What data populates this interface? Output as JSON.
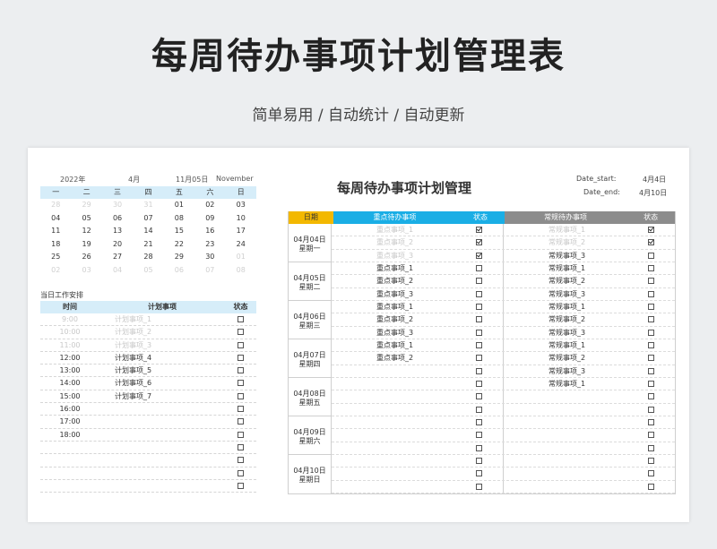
{
  "title": "每周待办事项计划管理表",
  "subtitle": "简单易用  /  自动统计  /  自动更新",
  "calendar": {
    "year": "2022年",
    "month": "4月",
    "date": "11月05日",
    "month_en": "November",
    "weekdays": [
      "一",
      "二",
      "三",
      "四",
      "五",
      "六",
      "日"
    ],
    "weeks": [
      [
        {
          "d": "28",
          "dim": true
        },
        {
          "d": "29",
          "dim": true
        },
        {
          "d": "30",
          "dim": true
        },
        {
          "d": "31",
          "dim": true
        },
        {
          "d": "01"
        },
        {
          "d": "02"
        },
        {
          "d": "03"
        }
      ],
      [
        {
          "d": "04"
        },
        {
          "d": "05"
        },
        {
          "d": "06"
        },
        {
          "d": "07"
        },
        {
          "d": "08"
        },
        {
          "d": "09"
        },
        {
          "d": "10"
        }
      ],
      [
        {
          "d": "11"
        },
        {
          "d": "12"
        },
        {
          "d": "13"
        },
        {
          "d": "14"
        },
        {
          "d": "15"
        },
        {
          "d": "16"
        },
        {
          "d": "17"
        }
      ],
      [
        {
          "d": "18"
        },
        {
          "d": "19"
        },
        {
          "d": "20"
        },
        {
          "d": "21"
        },
        {
          "d": "22"
        },
        {
          "d": "23"
        },
        {
          "d": "24"
        }
      ],
      [
        {
          "d": "25"
        },
        {
          "d": "26"
        },
        {
          "d": "27"
        },
        {
          "d": "28"
        },
        {
          "d": "29"
        },
        {
          "d": "30"
        },
        {
          "d": "01",
          "dim": true
        }
      ],
      [
        {
          "d": "02",
          "dim": true
        },
        {
          "d": "03",
          "dim": true
        },
        {
          "d": "04",
          "dim": true
        },
        {
          "d": "05",
          "dim": true
        },
        {
          "d": "06",
          "dim": true
        },
        {
          "d": "07",
          "dim": true
        },
        {
          "d": "08",
          "dim": true
        }
      ]
    ]
  },
  "daily": {
    "title": "当日工作安排",
    "headers": {
      "time": "时间",
      "plan": "计划事项",
      "status": "状态"
    },
    "rows": [
      {
        "time": "9:00",
        "plan": "计划事项_1",
        "done": true
      },
      {
        "time": "10:00",
        "plan": "计划事项_2",
        "done": true
      },
      {
        "time": "11:00",
        "plan": "计划事项_3",
        "done": true
      },
      {
        "time": "12:00",
        "plan": "计划事项_4",
        "done": false
      },
      {
        "time": "13:00",
        "plan": "计划事项_5",
        "done": false
      },
      {
        "time": "14:00",
        "plan": "计划事项_6",
        "done": false
      },
      {
        "time": "15:00",
        "plan": "计划事项_7",
        "done": false
      },
      {
        "time": "16:00",
        "plan": "",
        "done": false
      },
      {
        "time": "17:00",
        "plan": "",
        "done": false
      },
      {
        "time": "18:00",
        "plan": "",
        "done": false
      },
      {
        "time": "",
        "plan": "",
        "done": false
      },
      {
        "time": "",
        "plan": "",
        "done": false
      },
      {
        "time": "",
        "plan": "",
        "done": false
      },
      {
        "time": "",
        "plan": "",
        "done": false
      }
    ]
  },
  "weekly": {
    "title": "每周待办事项计划管理",
    "date_start_label": "Date_start:",
    "date_start": "4月4日",
    "date_end_label": "Date_end:",
    "date_end": "4月10日",
    "headers": {
      "date": "日期",
      "important": "重点待办事项",
      "status": "状态",
      "normal": "常规待办事项",
      "status2": "状态"
    },
    "days": [
      {
        "date": "04月04日",
        "weekday": "星期一"
      },
      {
        "date": "04月05日",
        "weekday": "星期二"
      },
      {
        "date": "04月06日",
        "weekday": "星期三"
      },
      {
        "date": "04月07日",
        "weekday": "星期四"
      },
      {
        "date": "04月08日",
        "weekday": "星期五"
      },
      {
        "date": "04月09日",
        "weekday": "星期六"
      },
      {
        "date": "04月10日",
        "weekday": "星期日"
      }
    ],
    "rows": [
      {
        "imp": "重点事项_1",
        "imp_done": true,
        "norm": "常规事项_1",
        "norm_done": true
      },
      {
        "imp": "重点事项_2",
        "imp_done": true,
        "norm": "常规事项_2",
        "norm_done": true
      },
      {
        "imp": "重点事项_3",
        "imp_done": true,
        "norm": "常规事项_3",
        "norm_done": false
      },
      {
        "imp": "重点事项_1",
        "imp_done": false,
        "norm": "常规事项_1",
        "norm_done": false
      },
      {
        "imp": "重点事项_2",
        "imp_done": false,
        "norm": "常规事项_2",
        "norm_done": false
      },
      {
        "imp": "重点事项_3",
        "imp_done": false,
        "norm": "常规事项_3",
        "norm_done": false
      },
      {
        "imp": "重点事项_1",
        "imp_done": false,
        "norm": "常规事项_1",
        "norm_done": false
      },
      {
        "imp": "重点事项_2",
        "imp_done": false,
        "norm": "常规事项_2",
        "norm_done": false
      },
      {
        "imp": "重点事项_3",
        "imp_done": false,
        "norm": "常规事项_3",
        "norm_done": false
      },
      {
        "imp": "重点事项_1",
        "imp_done": false,
        "norm": "常规事项_1",
        "norm_done": false
      },
      {
        "imp": "重点事项_2",
        "imp_done": false,
        "norm": "常规事项_2",
        "norm_done": false
      },
      {
        "imp": "",
        "imp_done": false,
        "norm": "常规事项_3",
        "norm_done": false
      },
      {
        "imp": "",
        "imp_done": false,
        "norm": "常规事项_1",
        "norm_done": false
      },
      {
        "imp": "",
        "imp_done": false,
        "norm": "",
        "norm_done": false
      },
      {
        "imp": "",
        "imp_done": false,
        "norm": "",
        "norm_done": false
      },
      {
        "imp": "",
        "imp_done": false,
        "norm": "",
        "norm_done": false
      },
      {
        "imp": "",
        "imp_done": false,
        "norm": "",
        "norm_done": false
      },
      {
        "imp": "",
        "imp_done": false,
        "norm": "",
        "norm_done": false
      },
      {
        "imp": "",
        "imp_done": false,
        "norm": "",
        "norm_done": false
      },
      {
        "imp": "",
        "imp_done": false,
        "norm": "",
        "norm_done": false
      },
      {
        "imp": "",
        "imp_done": false,
        "norm": "",
        "norm_done": false
      }
    ]
  }
}
